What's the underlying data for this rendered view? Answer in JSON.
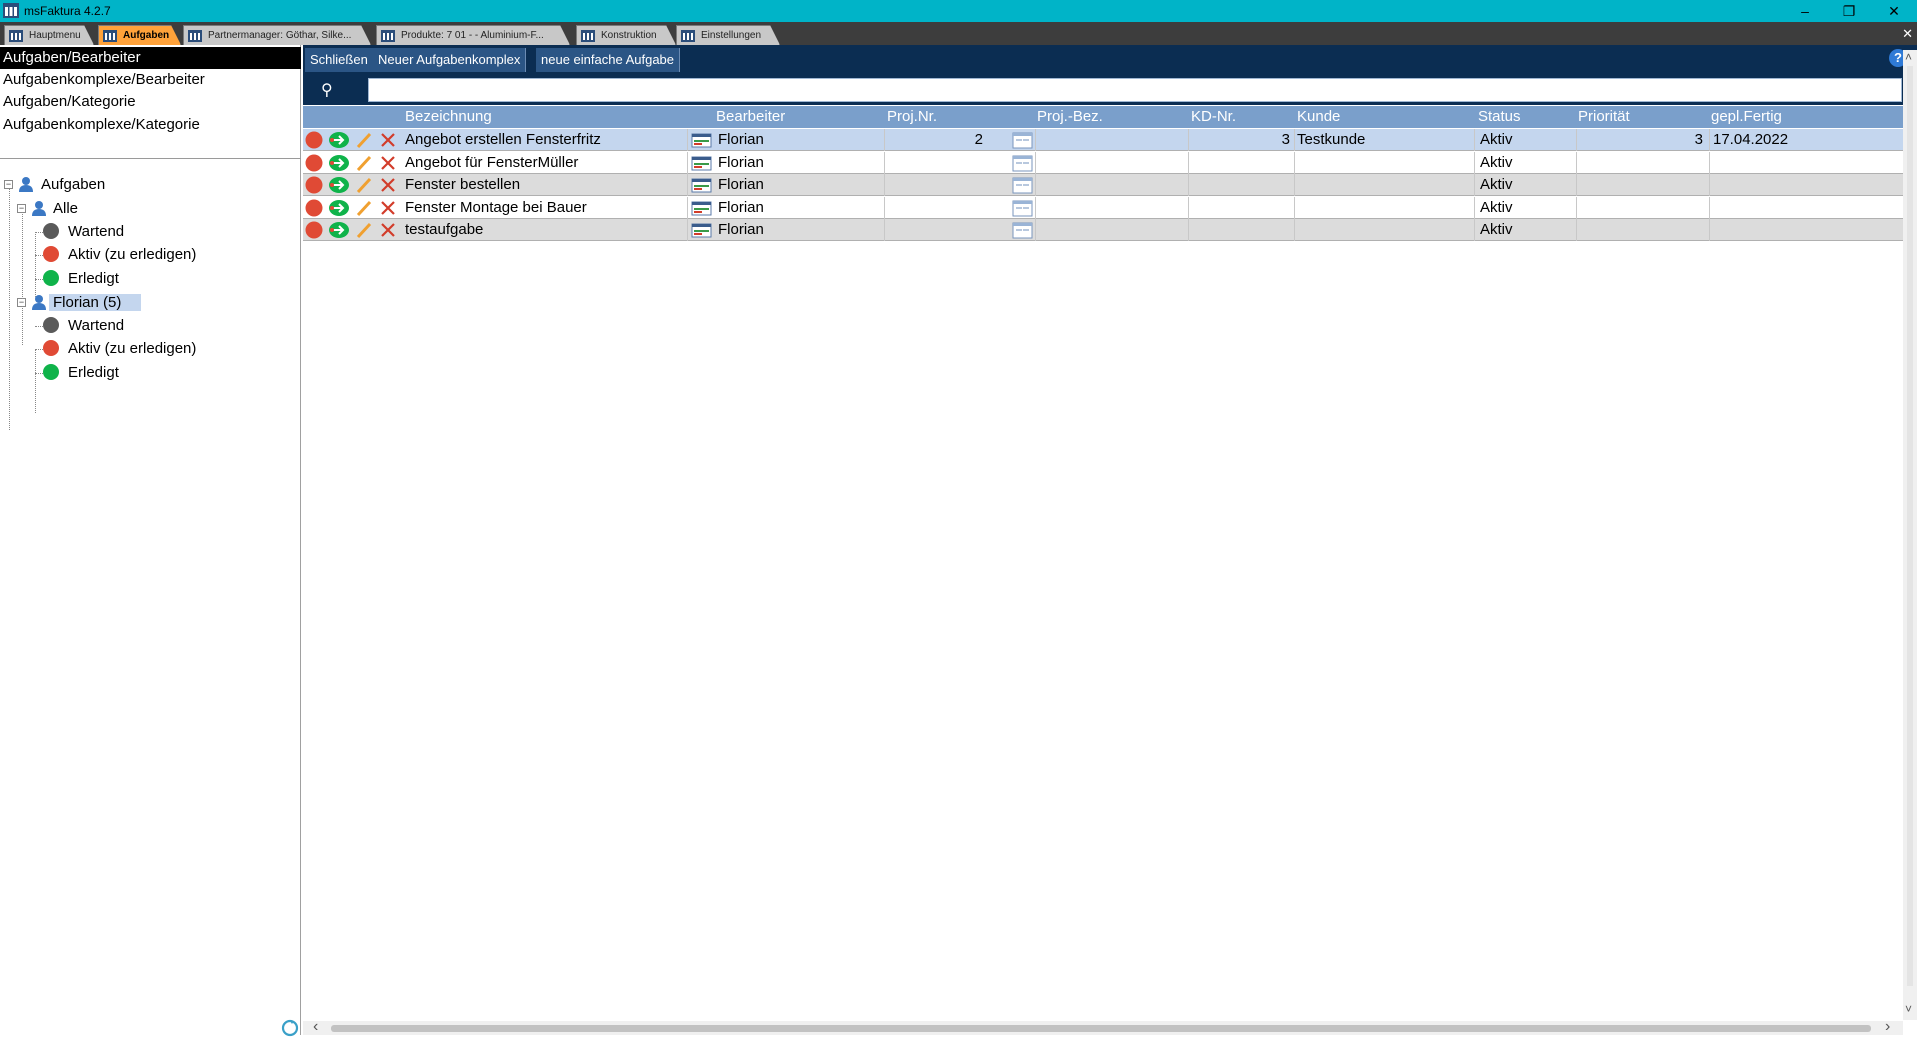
{
  "window": {
    "title": "msFaktura 4.2.7",
    "minimize": "–",
    "restore": "❐",
    "close": "✕"
  },
  "tabs": [
    {
      "label": "Hauptmenu"
    },
    {
      "label": "Aufgaben"
    },
    {
      "label": "Partnermanager: Göthar, Silke..."
    },
    {
      "label": "Produkte: 7 01 - - Aluminium-F..."
    },
    {
      "label": "Konstruktion"
    },
    {
      "label": "Einstellungen"
    }
  ],
  "tabbar_close": "✕",
  "views": [
    {
      "label": "Aufgaben/Bearbeiter"
    },
    {
      "label": "Aufgabenkomplexe/Bearbeiter"
    },
    {
      "label": "Aufgaben/Kategorie"
    },
    {
      "label": "Aufgabenkomplexe/Kategorie"
    }
  ],
  "tree": {
    "root": "Aufgaben",
    "alle": "Alle",
    "alle_children": [
      "Wartend",
      "Aktiv (zu erledigen)",
      "Erledigt"
    ],
    "user": "Florian (5)",
    "user_children": [
      "Wartend",
      "Aktiv (zu erledigen)",
      "Erledigt"
    ],
    "expander": "−"
  },
  "toolbar": {
    "close_label": "Schließen",
    "new_complex_label": "Neuer Aufgabenkomplex",
    "new_simple_label": "neue einfache Aufgabe",
    "help": "?"
  },
  "search": {
    "icon": "⚲",
    "value": "",
    "placeholder": ""
  },
  "columns": {
    "bezeichnung": "Bezeichnung",
    "bearbeiter": "Bearbeiter",
    "projnr": "Proj.Nr.",
    "projbez": "Proj.-Bez.",
    "kdnr": "KD-Nr.",
    "kunde": "Kunde",
    "status": "Status",
    "prioritaet": "Priorität",
    "geplfertig": "gepl.Fertig"
  },
  "rows": [
    {
      "bezeichnung": "Angebot erstellen Fensterfritz",
      "bearbeiter": "Florian",
      "projnr": "2",
      "projbez": "",
      "kdnr": "3",
      "kunde": "Testkunde",
      "status": "Aktiv",
      "prioritaet": "3",
      "geplfertig": "17.04.2022"
    },
    {
      "bezeichnung": "Angebot für FensterMüller",
      "bearbeiter": "Florian",
      "projnr": "",
      "projbez": "",
      "kdnr": "",
      "kunde": "",
      "status": "Aktiv",
      "prioritaet": "",
      "geplfertig": ""
    },
    {
      "bezeichnung": "Fenster bestellen",
      "bearbeiter": "Florian",
      "projnr": "",
      "projbez": "",
      "kdnr": "",
      "kunde": "",
      "status": "Aktiv",
      "prioritaet": "",
      "geplfertig": ""
    },
    {
      "bezeichnung": "Fenster Montage bei Bauer",
      "bearbeiter": "Florian",
      "projnr": "",
      "projbez": "",
      "kdnr": "",
      "kunde": "",
      "status": "Aktiv",
      "prioritaet": "",
      "geplfertig": ""
    },
    {
      "bezeichnung": "testaufgabe",
      "bearbeiter": "Florian",
      "projnr": "",
      "projbez": "",
      "kdnr": "",
      "kunde": "",
      "status": "Aktiv",
      "prioritaet": "",
      "geplfertig": ""
    }
  ],
  "colors": {
    "titlebar": "#00b4c8",
    "tab_active": "#ffa23a",
    "toolbar": "#0b2d52",
    "grid_header": "#7a9fcb",
    "row_selected": "#c4d6ee",
    "status_active": "#e04a35",
    "status_done": "#0fb34a",
    "status_waiting": "#5a5a5a"
  },
  "icons": {
    "row_status": "red-circle-icon",
    "row_open": "green-arrow-icon",
    "row_edit": "pencil-icon",
    "row_delete": "red-x-icon",
    "row_bearbeiter": "user-card-icon",
    "row_project": "calendar-icon",
    "tree_user": "user-icon",
    "refresh": "refresh-icon",
    "scroll_left": "‹",
    "scroll_right": "›",
    "scroll_up": "˄",
    "scroll_down": "˅"
  }
}
